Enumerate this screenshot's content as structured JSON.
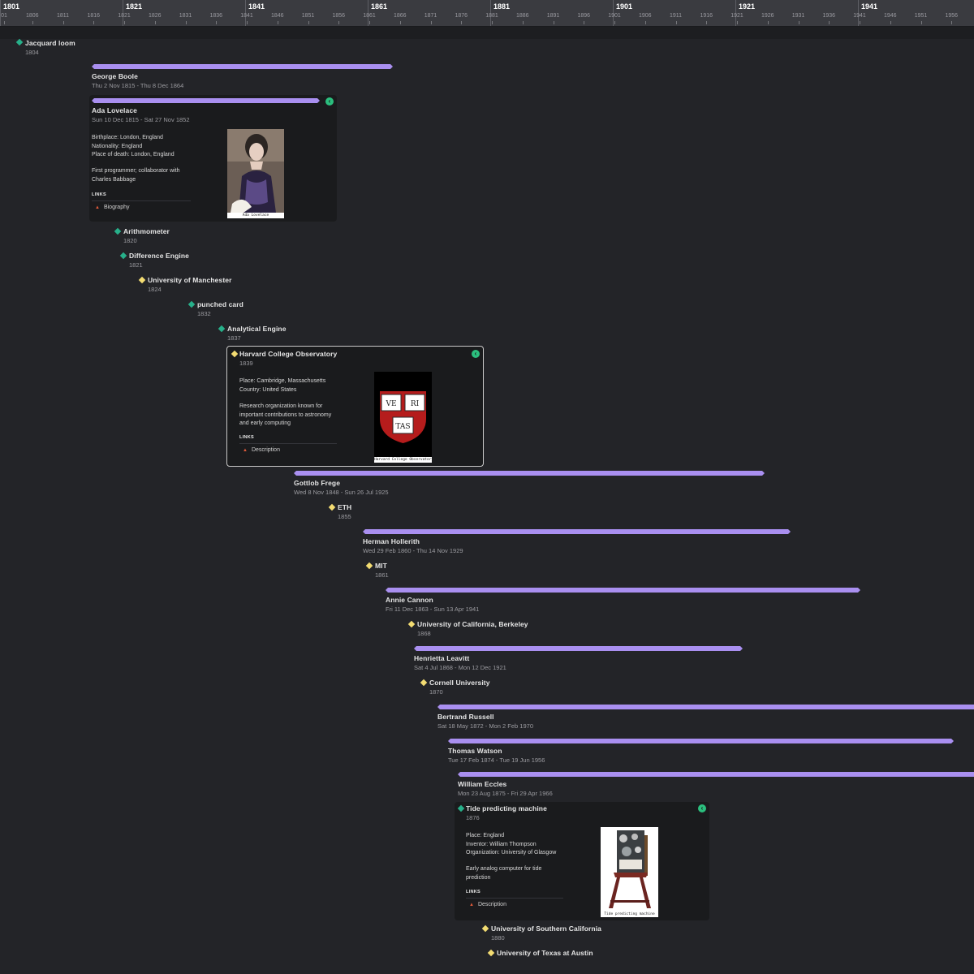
{
  "axis": {
    "major": [
      "1801",
      "1821",
      "1841",
      "1861",
      "1881",
      "1901",
      "1921",
      "1941"
    ],
    "minor": [
      "01",
      "1806",
      "1811",
      "1816",
      "1821",
      "1826",
      "1831",
      "1836",
      "1841",
      "1846",
      "1851",
      "1856",
      "1861",
      "1866",
      "1871",
      "1876",
      "1881",
      "1886",
      "1891",
      "1896",
      "1901",
      "1906",
      "1911",
      "1916",
      "1921",
      "1926",
      "1931",
      "1936",
      "1941",
      "1946",
      "1951",
      "1956"
    ]
  },
  "events": {
    "jacquard": {
      "title": "Jacquard loom",
      "date": "1804"
    },
    "boole": {
      "title": "George Boole",
      "date": "Thu 2 Nov 1815 - Thu 8 Dec 1864"
    },
    "lovelace": {
      "title": "Ada Lovelace",
      "date": "Sun 10 Dec 1815 - Sat 27 Nov 1852",
      "props": [
        "Birthplace: London, England",
        "Nationality: England",
        "Place of death: London, England"
      ],
      "desc": "First programmer; collaborator with Charles Babbage",
      "links_label": "LINKS",
      "link": "Biography",
      "caption": "Ada Lovelace",
      "close_icon": "‹"
    },
    "arithmometer": {
      "title": "Arithmometer",
      "date": "1820"
    },
    "difference": {
      "title": "Difference Engine",
      "date": "1821"
    },
    "manchester": {
      "title": "University of Manchester",
      "date": "1824"
    },
    "punched": {
      "title": "punched card",
      "date": "1832"
    },
    "analytical": {
      "title": "Analytical Engine",
      "date": "1837"
    },
    "harvard": {
      "title": "Harvard College Observatory",
      "date": "1839",
      "props": [
        "Place: Cambridge, Massachusetts",
        "Country: United States"
      ],
      "desc": "Research organization known for important contributions to astronomy and early computing",
      "links_label": "LINKS",
      "link": "Description",
      "caption": "Harvard College Observatory",
      "shield": [
        "VE",
        "RI",
        "TAS"
      ],
      "close_icon": "‹"
    },
    "frege": {
      "title": "Gottlob Frege",
      "date": "Wed 8 Nov 1848 - Sun 26 Jul 1925"
    },
    "eth": {
      "title": "ETH",
      "date": "1855"
    },
    "hollerith": {
      "title": "Herman Hollerith",
      "date": "Wed 29 Feb 1860 - Thu 14 Nov 1929"
    },
    "mit": {
      "title": "MIT",
      "date": "1861"
    },
    "cannon": {
      "title": "Annie Cannon",
      "date": "Fri 11 Dec 1863 - Sun 13 Apr 1941"
    },
    "berkeley": {
      "title": "University of California, Berkeley",
      "date": "1868"
    },
    "leavitt": {
      "title": "Henrietta Leavitt",
      "date": "Sat 4 Jul 1868 - Mon 12 Dec 1921"
    },
    "cornell": {
      "title": "Cornell University",
      "date": "1870"
    },
    "russell": {
      "title": "Bertrand Russell",
      "date": "Sat 18 May 1872 - Mon 2 Feb 1970"
    },
    "watson": {
      "title": "Thomas Watson",
      "date": "Tue 17 Feb 1874 - Tue 19 Jun 1956"
    },
    "eccles": {
      "title": "William Eccles",
      "date": "Mon 23 Aug 1875 - Fri 29 Apr 1966"
    },
    "tide": {
      "title": "Tide predicting machine",
      "date": "1876",
      "props": [
        "Place: England",
        "Inventor: William Thompson",
        "Organization: University of Glasgow"
      ],
      "desc": "Early analog computer for tide prediction",
      "links_label": "LINKS",
      "link": "Description",
      "caption": "Tide predicting machine",
      "close_icon": "‹"
    },
    "usc": {
      "title": "University of Southern California",
      "date": "1880"
    },
    "texas": {
      "title": "University of Texas at Austin",
      "date": ""
    }
  },
  "colors": {
    "bar": "#a98ff0",
    "item_marker": "#27b08a",
    "org_marker": "#f3dc72",
    "link_bullet": "#e05a3a",
    "close": "#2bbf7e"
  }
}
